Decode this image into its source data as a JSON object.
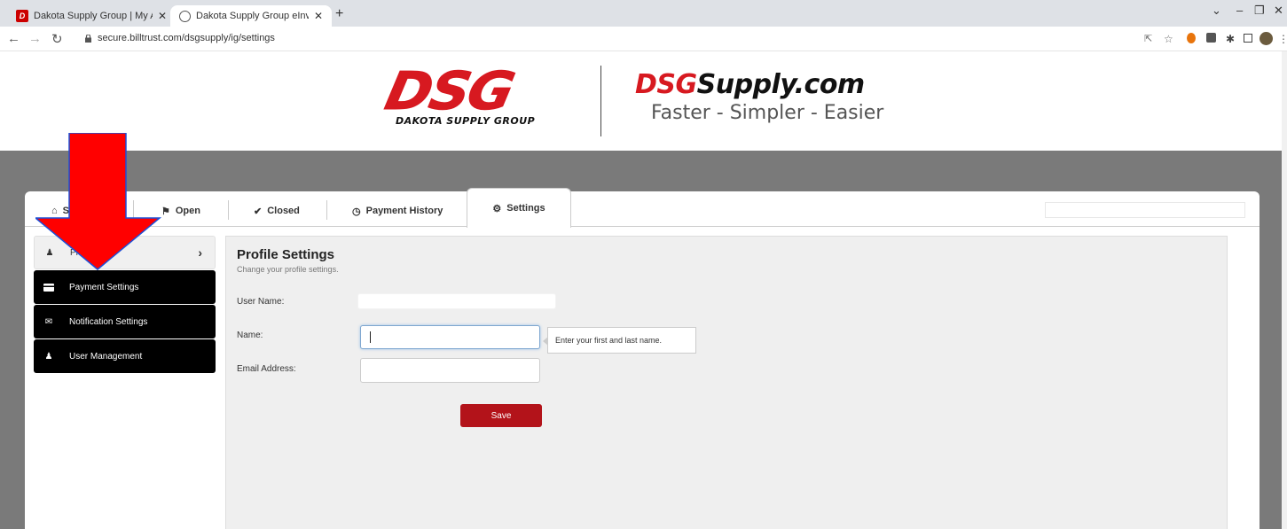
{
  "browser": {
    "tabs": [
      {
        "title": "Dakota Supply Group | My Accou",
        "favicon": "dsg-logo-icon",
        "active": false
      },
      {
        "title": "Dakota Supply Group eInvoice C",
        "favicon": "globe-icon",
        "active": true
      }
    ],
    "new_tab_label": "+",
    "url": "secure.billtrust.com/dsgsupply/ig/settings"
  },
  "header": {
    "logo_main": "DSG",
    "logo_sub": "DAKOTA SUPPLY GROUP",
    "logo2_red": "DSG",
    "logo2_black": "Supply.com",
    "tagline": "Faster - Simpler - Easier"
  },
  "tabs": [
    {
      "label": "S",
      "icon": "home-icon"
    },
    {
      "label": "Open",
      "icon": "flag-icon"
    },
    {
      "label": "Closed",
      "icon": "check-icon"
    },
    {
      "label": "Payment History",
      "icon": "clock-icon"
    },
    {
      "label": "Settings",
      "icon": "gear-icon",
      "active": true
    }
  ],
  "sidebar": {
    "items": [
      {
        "label": "Pro",
        "icon": "user-icon"
      },
      {
        "label": "Payment Settings",
        "icon": "credit-card-icon"
      },
      {
        "label": "Notification Settings",
        "icon": "envelope-icon"
      },
      {
        "label": "User Management",
        "icon": "user-icon"
      }
    ]
  },
  "profile": {
    "title": "Profile Settings",
    "subtitle": "Change your profile settings.",
    "fields": {
      "user_name_label": "User Name:",
      "user_name_value": "",
      "name_label": "Name:",
      "name_value": "",
      "email_label": "Email Address:",
      "email_value": ""
    },
    "tooltip": "Enter your first and last name.",
    "save_label": "Save"
  },
  "colors": {
    "brand_red": "#d71920",
    "save_button": "#b3131a",
    "arrow": "#ff0000"
  }
}
